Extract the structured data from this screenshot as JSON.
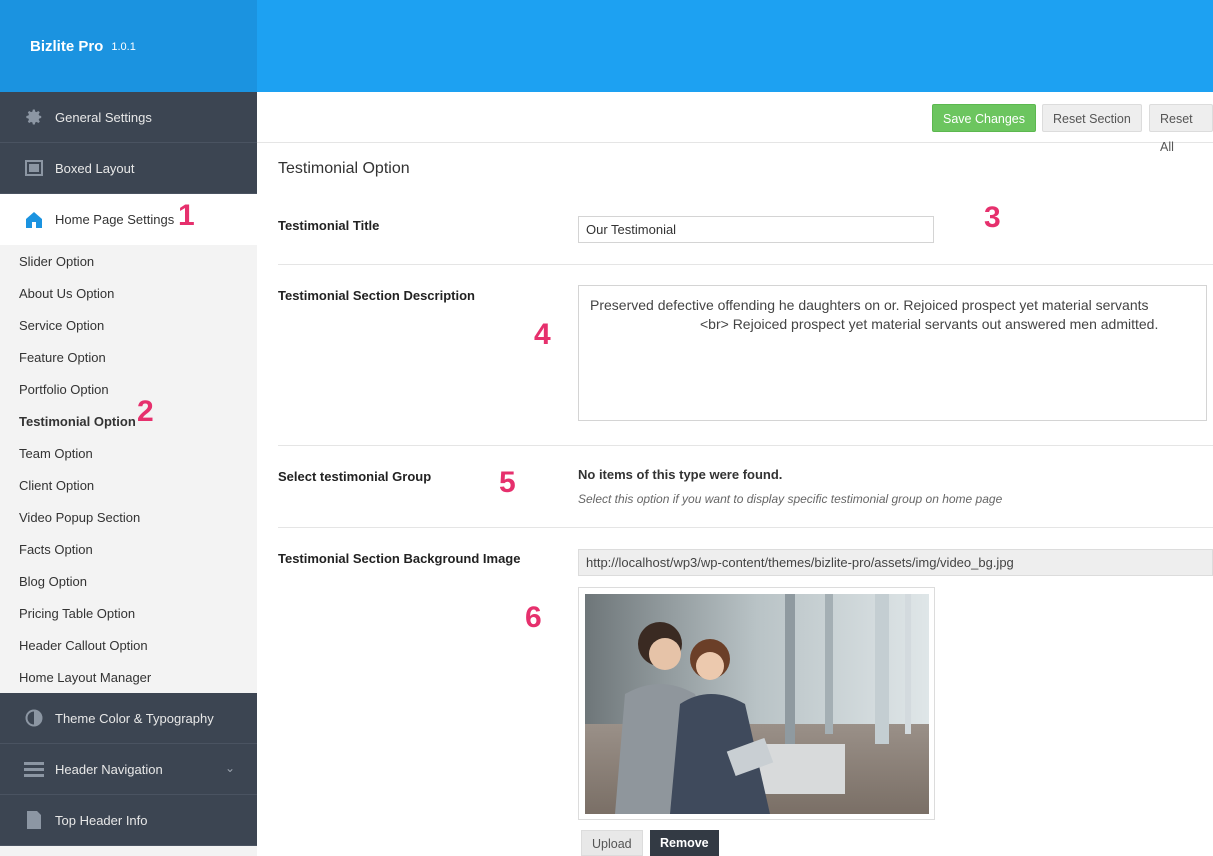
{
  "app": {
    "name": "Bizlite Pro",
    "version": "1.0.1"
  },
  "sidebar": {
    "top_items": [
      {
        "label": "General Settings",
        "icon": "gear-icon"
      },
      {
        "label": "Boxed Layout",
        "icon": "layout-icon"
      },
      {
        "label": "Home Page Settings",
        "icon": "home-icon"
      }
    ],
    "sub_items": [
      "Slider Option",
      "About Us Option",
      "Service Option",
      "Feature Option",
      "Portfolio Option",
      "Testimonial Option",
      "Team Option",
      "Client Option",
      "Video Popup Section",
      "Facts Option",
      "Blog Option",
      "Pricing Table Option",
      "Header Callout Option",
      "Home Layout Manager"
    ],
    "bottom_items": [
      {
        "label": "Theme Color & Typography",
        "icon": "contrast-icon"
      },
      {
        "label": "Header Navigation",
        "icon": "menu-icon"
      },
      {
        "label": "Top Header Info",
        "icon": "document-icon"
      }
    ]
  },
  "toolbar": {
    "save_label": "Save Changes",
    "reset_section_label": "Reset Section",
    "reset_all_label": "Reset All"
  },
  "section": {
    "title": "Testimonial Option",
    "fields": {
      "title_label": "Testimonial Title",
      "title_value": "Our Testimonial",
      "description_label": "Testimonial Section Description",
      "description_line1": "Preserved defective offending he daughters on or. Rejoiced prospect yet material servants",
      "description_line2": "<br> Rejoiced prospect yet material servants out answered men admitted.",
      "group_label": "Select testimonial Group",
      "group_empty": "No items of this type were found.",
      "group_hint": "Select this option if you want to display specific testimonial group on home page",
      "bg_label": "Testimonial Section Background Image",
      "bg_url": "http://localhost/wp3/wp-content/themes/bizlite-pro/assets/img/video_bg.jpg",
      "upload_label": "Upload",
      "remove_label": "Remove"
    }
  },
  "markers": [
    "1",
    "2",
    "3",
    "4",
    "5",
    "6"
  ],
  "colors": {
    "brand": "#1b93e0",
    "header": "#1da1f2",
    "sidebar_dark": "#3c4552",
    "save_button": "#6cc55f",
    "marker": "#e6306d"
  }
}
